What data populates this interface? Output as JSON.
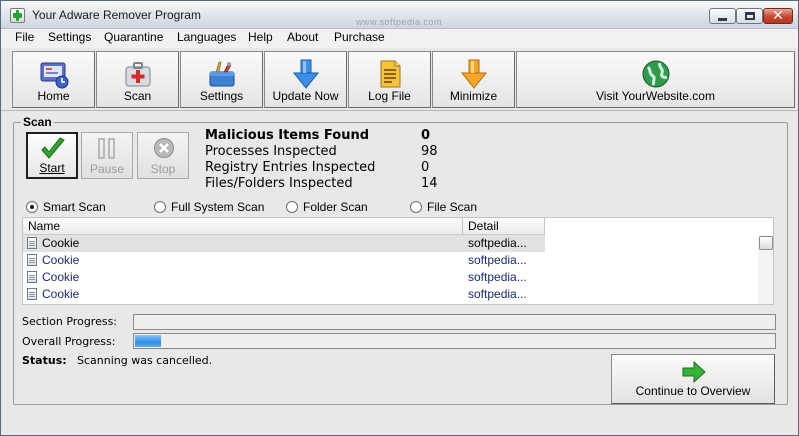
{
  "window": {
    "title": "Your Adware Remover Program",
    "watermark": "www.softpedia.com"
  },
  "menu": [
    "File",
    "Settings",
    "Quarantine",
    "Languages",
    "Help",
    "About",
    "Purchase"
  ],
  "toolbar": {
    "home": "Home",
    "scan": "Scan",
    "settings": "Settings",
    "update": "Update Now",
    "logfile": "Log File",
    "minimize": "Minimize",
    "visit": "Visit YourWebsite.com"
  },
  "scan": {
    "section_title": "Scan",
    "buttons": {
      "start": "Start",
      "pause": "Pause",
      "stop": "Stop"
    },
    "stats": [
      {
        "label": "Malicious Items Found",
        "value": "0"
      },
      {
        "label": "Processes Inspected",
        "value": "98"
      },
      {
        "label": "Registry Entries Inspected",
        "value": "0"
      },
      {
        "label": "Files/Folders Inspected",
        "value": "14"
      }
    ],
    "modes": [
      "Smart Scan",
      "Full System Scan",
      "Folder Scan",
      "File Scan"
    ],
    "selected_mode": "Smart Scan",
    "columns": {
      "name": "Name",
      "detail": "Detail"
    },
    "rows": [
      {
        "name": "Cookie",
        "detail": "softpedia..."
      },
      {
        "name": "Cookie",
        "detail": "softpedia..."
      },
      {
        "name": "Cookie",
        "detail": "softpedia..."
      },
      {
        "name": "Cookie",
        "detail": "softpedia..."
      }
    ]
  },
  "progress": {
    "section_label": "Section Progress:",
    "section_value": 0,
    "overall_label": "Overall Progress:",
    "overall_value": 0.04
  },
  "status": {
    "label": "Status:",
    "text": "Scanning was cancelled."
  },
  "continue_button": "Continue to Overview",
  "colors": {
    "accent_green": "#2fa82f",
    "progress_blue": "#2f8fe8",
    "link_text": "#1a2a7a"
  }
}
